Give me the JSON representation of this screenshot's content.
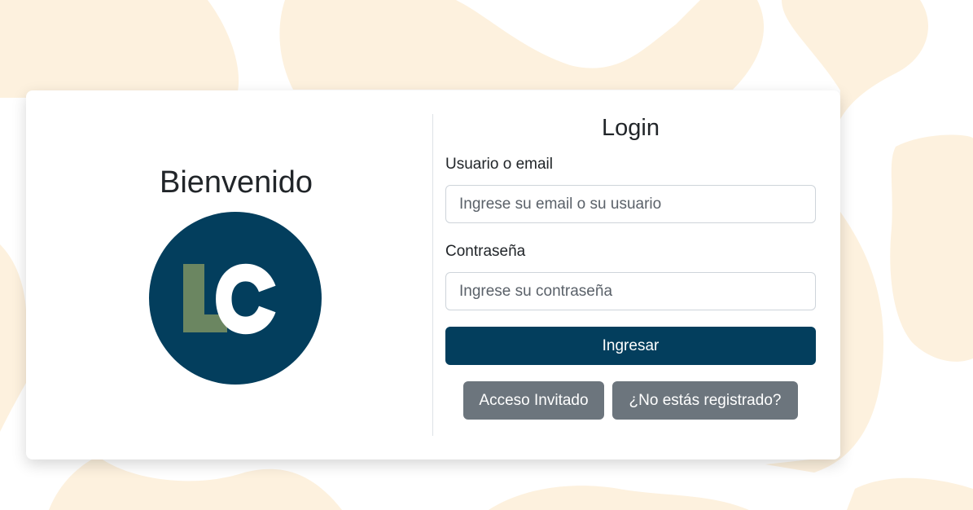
{
  "left": {
    "welcome_title": "Bienvenido",
    "logo_text": "LC",
    "logo_circle_color": "#033e5d",
    "logo_l_color": "#6b8661",
    "logo_c_color": "#ffffff"
  },
  "login": {
    "title": "Login",
    "user_label": "Usuario o email",
    "user_placeholder": "Ingrese su email o su usuario",
    "password_label": "Contraseña",
    "password_placeholder": "Ingrese su contraseña",
    "submit_label": "Ingresar",
    "guest_label": "Acceso Invitado",
    "register_label": "¿No estás registrado?"
  },
  "colors": {
    "primary": "#033e5d",
    "secondary": "#6c757d",
    "background_blob": "#fdf1de"
  }
}
